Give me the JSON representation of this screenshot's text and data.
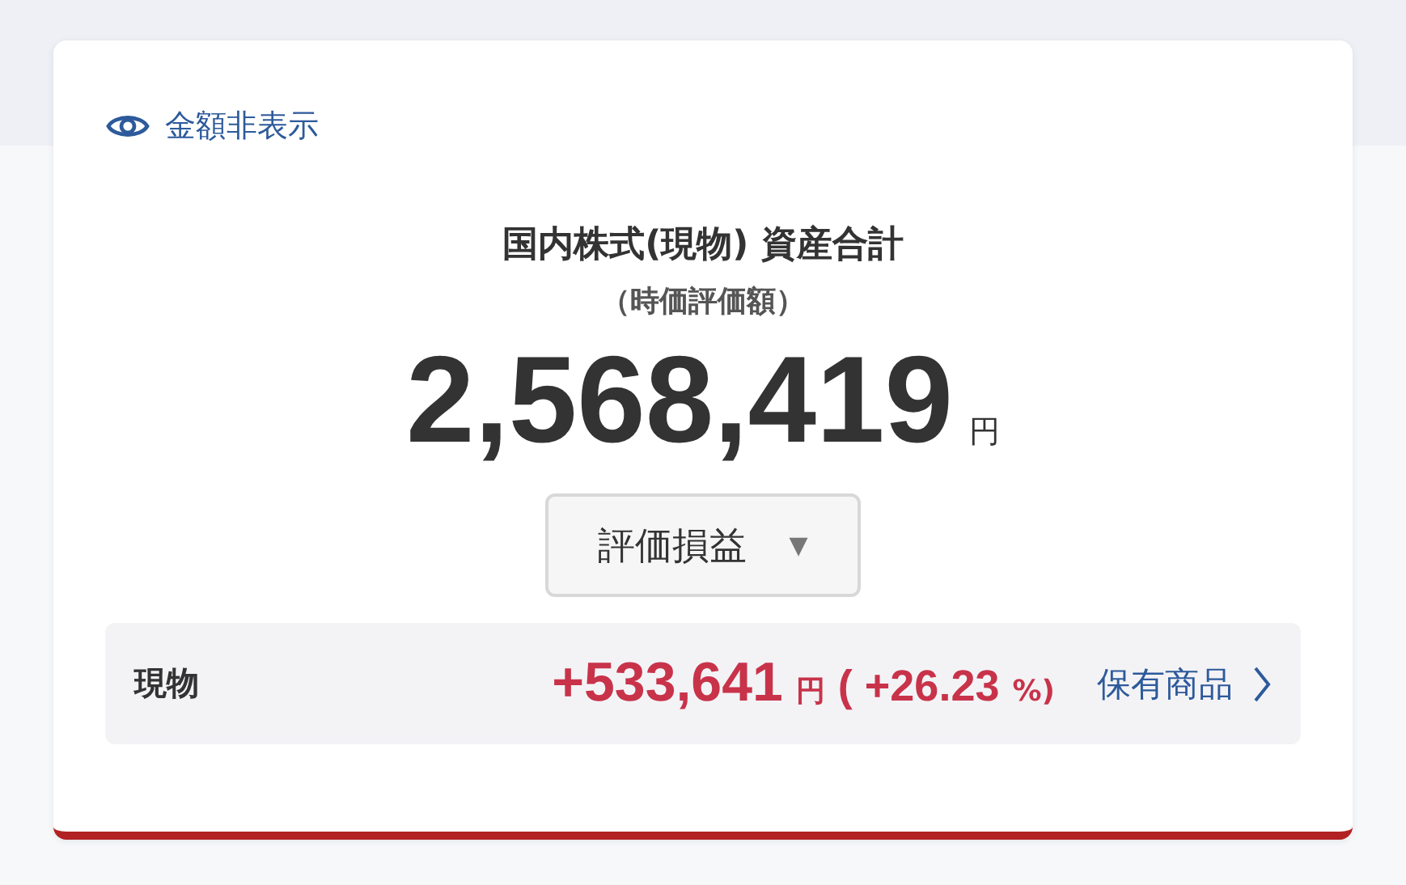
{
  "toggle": {
    "label": "金額非表示"
  },
  "summary": {
    "title": "国内株式(現物) 資産合計",
    "subtitle": "（時価評価額）",
    "amount": "2,568,419",
    "unit": "円"
  },
  "dropdown": {
    "label": "評価損益",
    "caret": "▼"
  },
  "row": {
    "label": "現物",
    "gain": "+533,641",
    "gain_unit": "円",
    "rate": "( +26.23",
    "rate_unit": "%)",
    "link": "保有商品"
  }
}
